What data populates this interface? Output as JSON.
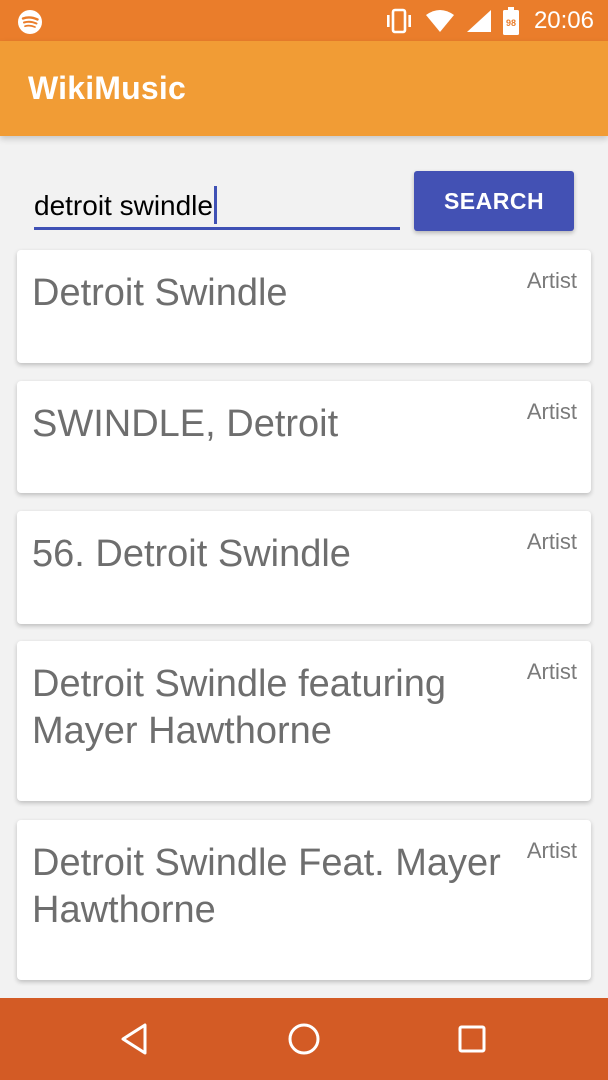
{
  "status_bar": {
    "time": "20:06",
    "battery_level": "98",
    "icons": [
      "spotify-icon",
      "vibrate-icon",
      "wifi-icon",
      "signal-icon",
      "battery-icon"
    ]
  },
  "app_bar": {
    "title": "WikiMusic"
  },
  "search": {
    "value": "detroit swindle",
    "button_label": "SEARCH"
  },
  "results": [
    {
      "title": "Detroit Swindle",
      "type": "Artist"
    },
    {
      "title": "SWINDLE, Detroit",
      "type": "Artist"
    },
    {
      "title": "56. Detroit Swindle",
      "type": "Artist"
    },
    {
      "title": "Detroit Swindle featuring Mayer Hawthorne",
      "type": "Artist"
    },
    {
      "title": "Detroit Swindle Feat. Mayer Hawthorne",
      "type": "Artist"
    }
  ],
  "nav_bar": {
    "icons": [
      "back-icon",
      "home-icon",
      "recents-icon"
    ]
  },
  "colors": {
    "status_bar": "#ea7d2b",
    "app_bar": "#f19c35",
    "accent": "#3f51b5",
    "nav_bar": "#d35b25"
  }
}
